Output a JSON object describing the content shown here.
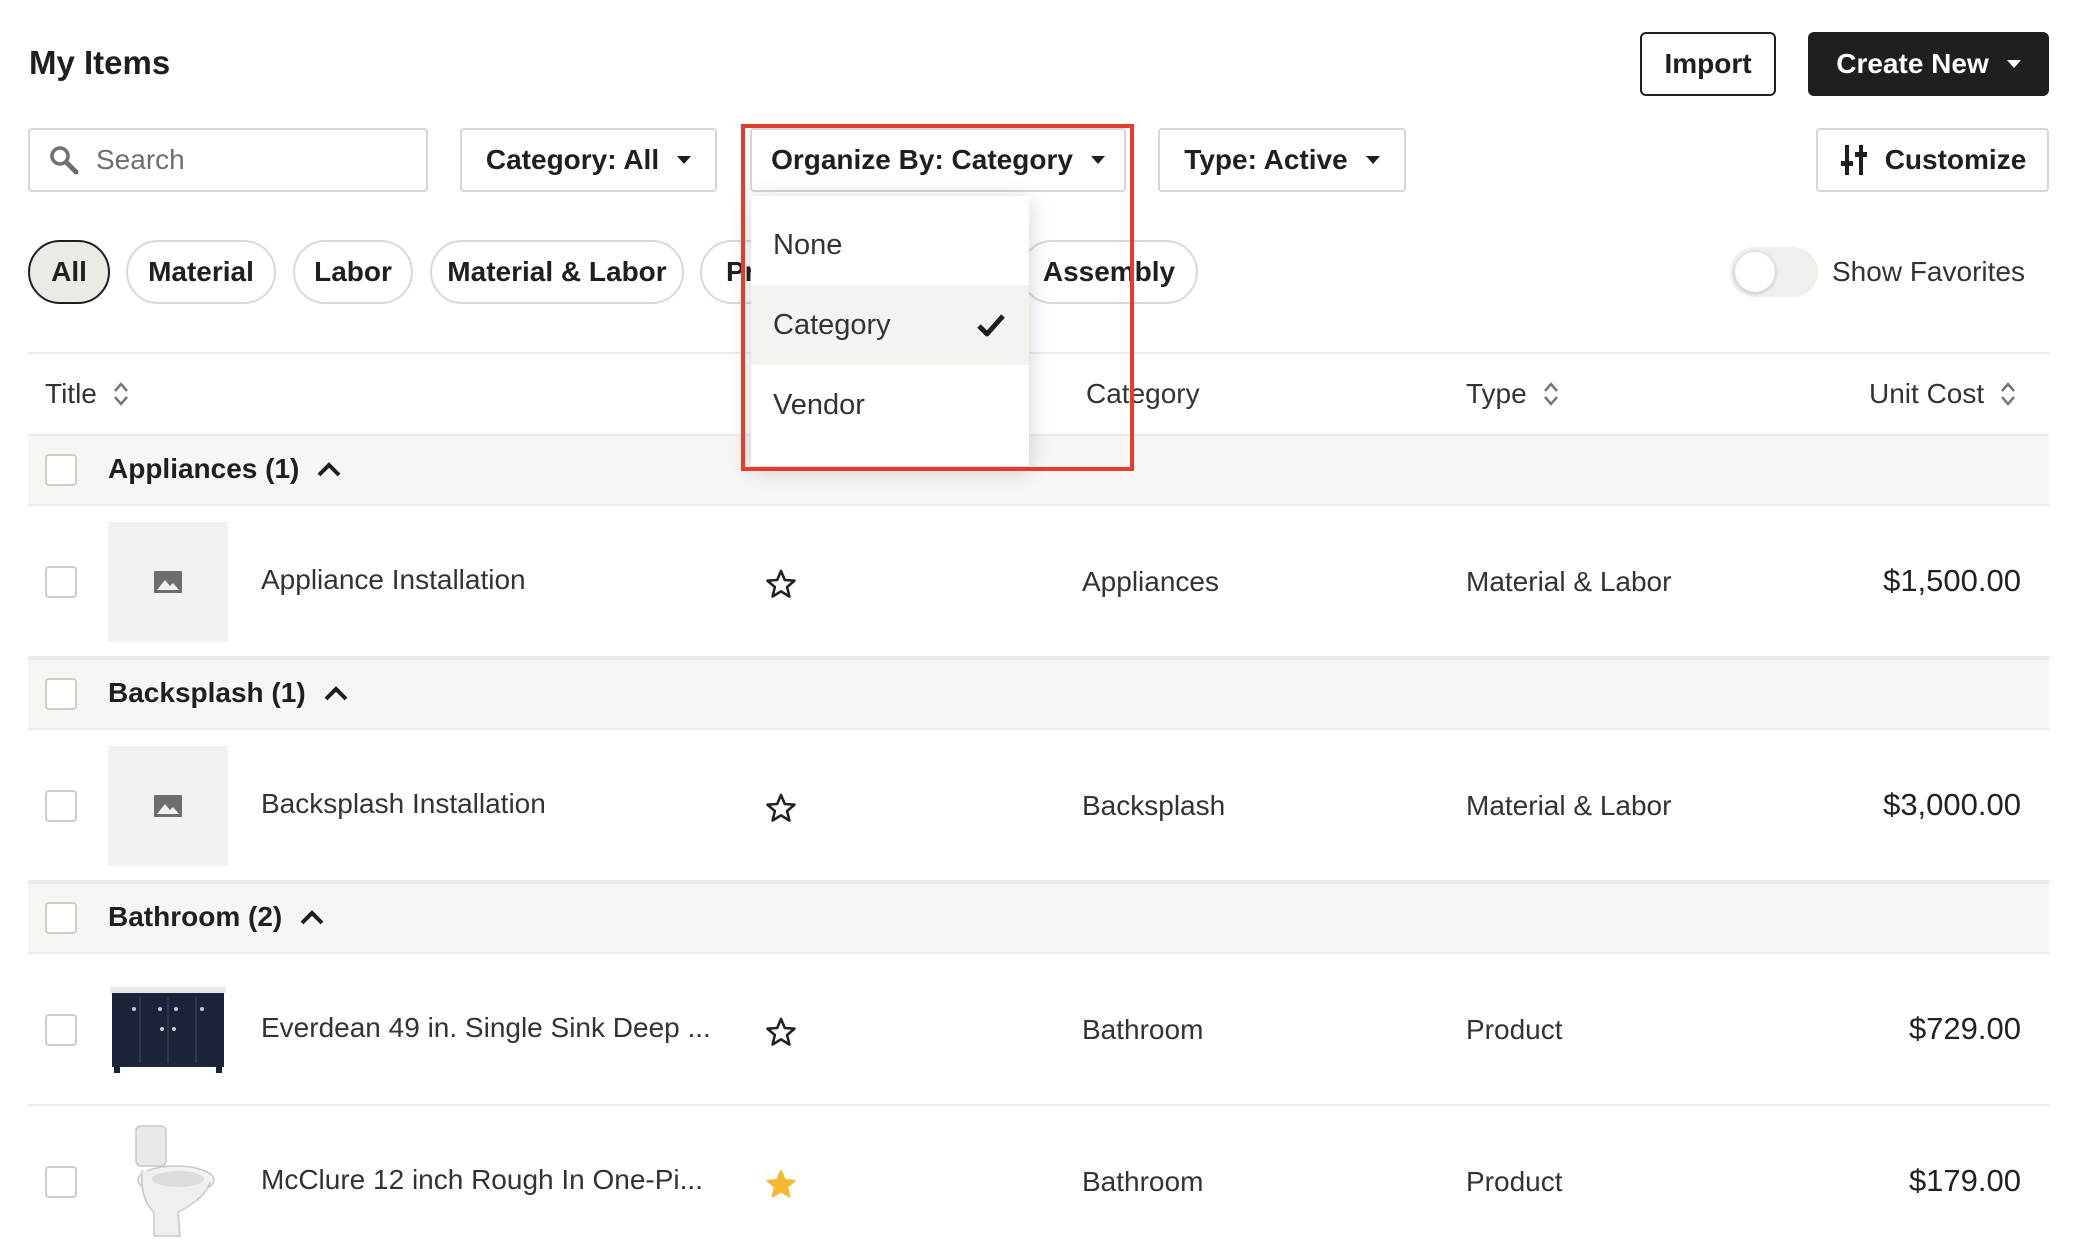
{
  "header": {
    "title": "My Items",
    "import_label": "Import",
    "create_label": "Create New"
  },
  "toolbar": {
    "search_placeholder": "Search",
    "category_filter": "Category: All",
    "organize_filter": "Organize By: Category",
    "type_filter": "Type: Active",
    "customize_label": "Customize"
  },
  "chips": [
    {
      "label": "All",
      "active": true
    },
    {
      "label": "Material",
      "active": false
    },
    {
      "label": "Labor",
      "active": false
    },
    {
      "label": "Material & Labor",
      "active": false
    },
    {
      "label": "Pr",
      "active": false
    },
    {
      "label": "Assembly",
      "active": false
    }
  ],
  "favorites": {
    "label": "Show Favorites",
    "enabled": false
  },
  "dropdown": {
    "options": [
      "None",
      "Category",
      "Vendor"
    ],
    "selected": "Category"
  },
  "table": {
    "columns": {
      "title": "Title",
      "category": "Category",
      "type": "Type",
      "unit_cost": "Unit Cost"
    },
    "groups": [
      {
        "label": "Appliances (1)",
        "items": [
          {
            "title": "Appliance Installation",
            "category": "Appliances",
            "type": "Material & Labor",
            "unit_cost": "$1,500.00",
            "favorite": false,
            "thumb": "image-placeholder-icon"
          }
        ]
      },
      {
        "label": "Backsplash (1)",
        "items": [
          {
            "title": "Backsplash Installation",
            "category": "Backsplash",
            "type": "Material & Labor",
            "unit_cost": "$3,000.00",
            "favorite": false,
            "thumb": "image-placeholder-icon"
          }
        ]
      },
      {
        "label": "Bathroom (2)",
        "items": [
          {
            "title": "Everdean 49 in. Single Sink Deep ...",
            "category": "Bathroom",
            "type": "Product",
            "unit_cost": "$729.00",
            "favorite": false,
            "thumb": "vanity-image"
          },
          {
            "title": "McClure 12 inch Rough In One-Pi...",
            "category": "Bathroom",
            "type": "Product",
            "unit_cost": "$179.00",
            "favorite": true,
            "thumb": "toilet-image"
          }
        ]
      }
    ]
  },
  "colors": {
    "accent_dark": "#1f1f1f",
    "highlight_red": "#e53c2b",
    "favorite_star": "#f5b82e",
    "group_bg": "#f7f6f3"
  }
}
